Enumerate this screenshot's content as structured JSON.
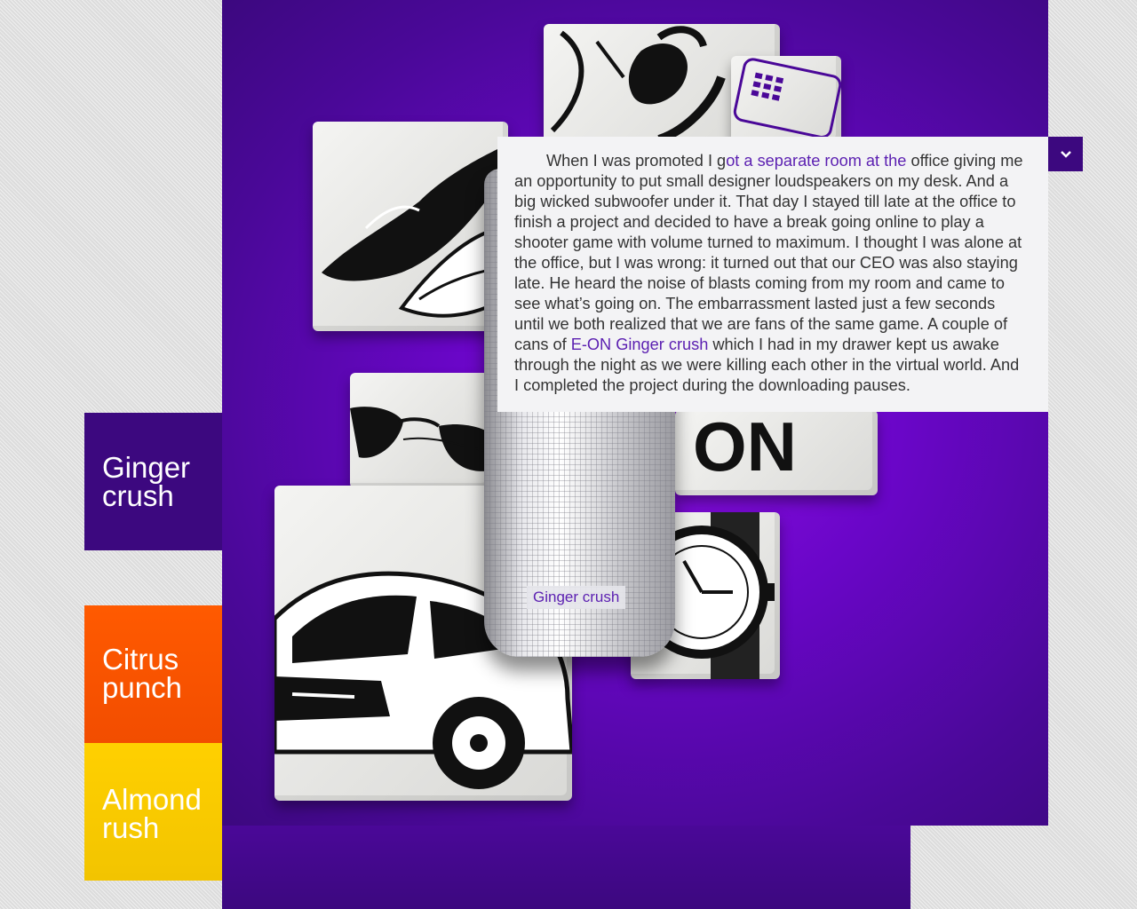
{
  "story": {
    "text_before": "When I was promoted I g",
    "link1": "ot a separate room at the",
    "text_mid": " office giving me an opportunity to put small designer loudspeakers on my desk. And a big wicked subwoofer under it. That day I stayed till late at the office to finish a project and decided to have a break going online to play a shooter game with volume turned to maximum. I thought I was alone at the office, but I was wrong: it turned out that our CEO was also staying late. He heard the noise of blasts coming from my room and came to see what’s going on. The embarrassment lasted just a few seconds until we both realized that we are fans of the same game. A couple of cans of ",
    "link2": "E-ON Ginger crush",
    "text_after": " which I had in my drawer kept us awake through the night as we were killing each other in the virtual world. And I completed the project during the downloading pauses."
  },
  "can_label": "Ginger crush",
  "tile_lettering": "ON",
  "flavors": [
    {
      "label": "Ginger crush",
      "color": "#3c087f"
    },
    {
      "label": "Citrus punch",
      "color": "#ff5a00"
    },
    {
      "label": "Almond rush",
      "color": "#ffd000"
    }
  ],
  "toggle_icon": "chevron-down-icon",
  "accent_color": "#5b1fb1"
}
